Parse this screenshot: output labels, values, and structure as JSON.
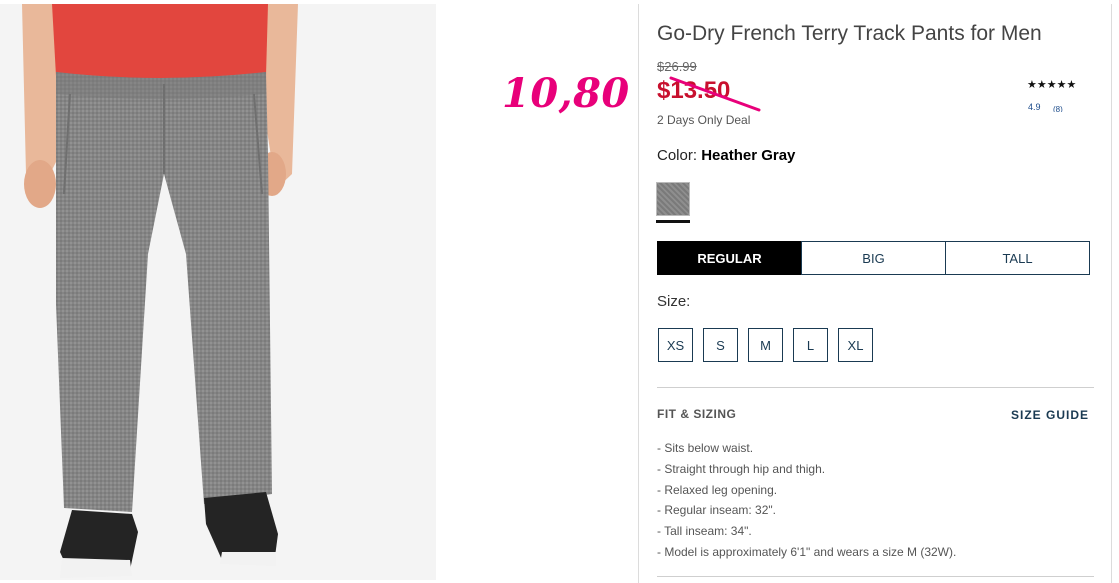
{
  "annotation": {
    "handwritten_price": "10,80"
  },
  "product": {
    "title": "Go-Dry French Terry Track Pants for Men",
    "original_price": "$26.99",
    "sale_price": "$13.50",
    "deal_text": "2 Days Only Deal",
    "rating": {
      "stars": "★★★★★",
      "score": "4.9",
      "count": "(8)"
    }
  },
  "color": {
    "label": "Color:",
    "value": "Heather Gray",
    "swatch_hex": "#858585"
  },
  "fit_options": {
    "items": [
      {
        "label": "REGULAR",
        "selected": true
      },
      {
        "label": "BIG",
        "selected": false
      },
      {
        "label": "TALL",
        "selected": false
      }
    ]
  },
  "size": {
    "label": "Size:",
    "options": [
      "XS",
      "S",
      "M",
      "L",
      "XL"
    ]
  },
  "fit_sizing": {
    "heading": "FIT & SIZING",
    "size_guide_label": "SIZE GUIDE",
    "bullets": [
      "- Sits below waist.",
      "- Straight through hip and thigh.",
      "- Relaxed leg opening.",
      "- Regular inseam: 32\".",
      "- Tall inseam: 34\".",
      "- Model is approximately 6'1\" and wears a size M (32W)."
    ]
  },
  "colors": {
    "sale_red": "#c8102e",
    "annotation_pink": "#e8007a",
    "button_navy": "#1a3a52"
  }
}
